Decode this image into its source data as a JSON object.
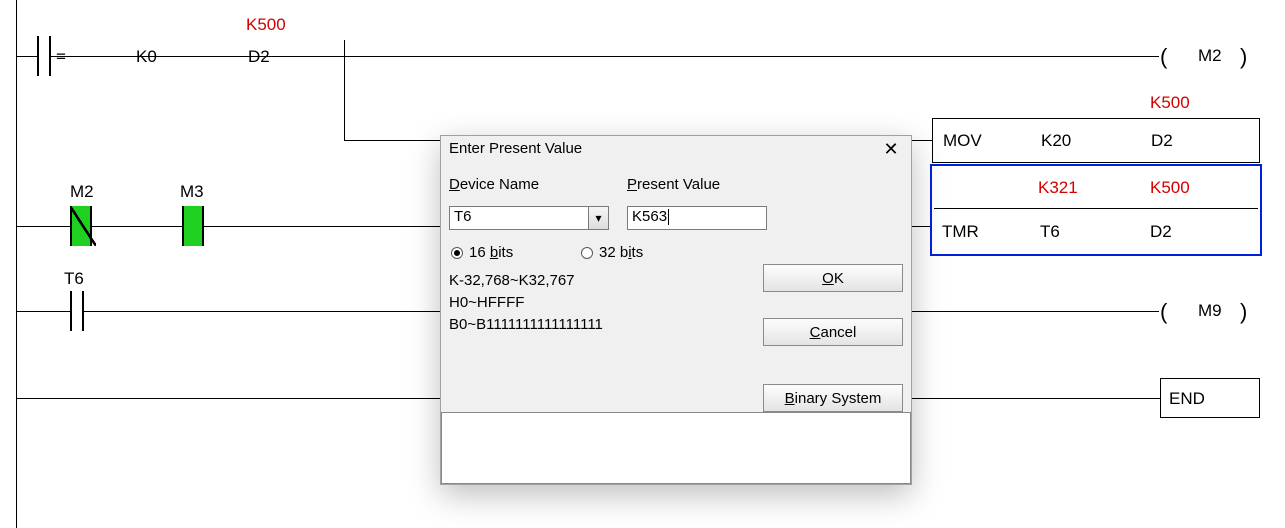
{
  "rung1": {
    "cmp": {
      "op": "=",
      "a": "K0",
      "b": "D2",
      "b_mon": "K500"
    },
    "coil": "M2",
    "mov": {
      "op": "MOV",
      "src": "K20",
      "dst": "D2",
      "dst_mon": "K500"
    },
    "tmr": {
      "op": "TMR",
      "t": "T6",
      "d": "D2",
      "t_mon": "K321",
      "d_mon": "K500"
    }
  },
  "rung2": {
    "c1": {
      "label": "M2"
    },
    "c2": {
      "label": "M3"
    }
  },
  "rung3": {
    "c1": {
      "label": "T6"
    },
    "coil": "M9"
  },
  "rung4": {
    "op": "END"
  },
  "dialog": {
    "title": "Enter Present Value",
    "device_label_u": "D",
    "device_label_rest": "evice Name",
    "pv_label_u": "P",
    "pv_label_rest": "resent Value",
    "device_value": "T6",
    "pv_value": "K563",
    "radio16_pre": "16 ",
    "radio16_u": "b",
    "radio16_post": "its",
    "radio32_pre": "32 b",
    "radio32_u": "i",
    "radio32_post": "ts",
    "range_k": "K-32,768~K32,767",
    "range_h": "H0~HFFFF",
    "range_b": "B0~B1111111111111111",
    "ok_u": "O",
    "ok_rest": "K",
    "cancel_u": "C",
    "cancel_rest": "ancel",
    "bin_u": "B",
    "bin_rest": "inary System"
  }
}
